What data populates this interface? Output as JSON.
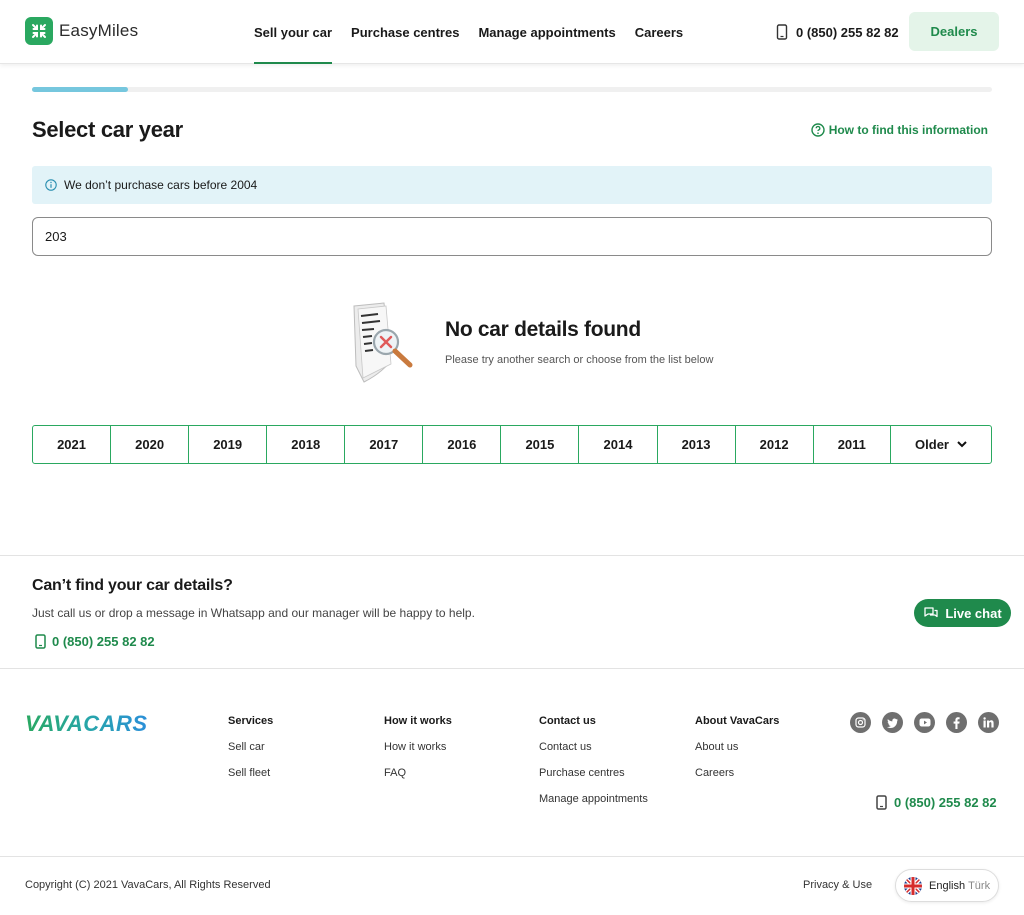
{
  "header": {
    "brand": "EasyMiles",
    "nav": [
      {
        "label": "Sell your car",
        "active": true
      },
      {
        "label": "Purchase centres",
        "active": false
      },
      {
        "label": "Manage appointments",
        "active": false
      },
      {
        "label": "Careers",
        "active": false
      }
    ],
    "phone": "0 (850) 255 82 82",
    "dealers_label": "Dealers"
  },
  "progress": {
    "fraction": 0.1
  },
  "step": {
    "title": "Select car year",
    "help_link": "How to find this information",
    "info": "We don’t purchase cars before 2004",
    "search_value": "203"
  },
  "empty_state": {
    "title": "No car details found",
    "subtitle": "Please try another search or choose from the list below"
  },
  "years": [
    "2021",
    "2020",
    "2019",
    "2018",
    "2017",
    "2016",
    "2015",
    "2014",
    "2013",
    "2012",
    "2011"
  ],
  "older_label": "Older",
  "cant_find": {
    "title": "Can’t find your car details?",
    "text": "Just call us or drop a message in Whatsapp and our manager will be happy to help.",
    "phone": "0 (850) 255 82 82",
    "live_chat": "Live chat"
  },
  "footer": {
    "logo_text": "VAVACARS",
    "columns": [
      {
        "head": "Services",
        "links": [
          "Sell car",
          "Sell fleet"
        ]
      },
      {
        "head": "How it works",
        "links": [
          "How it works",
          "FAQ"
        ]
      },
      {
        "head": "Contact us",
        "links": [
          "Contact us",
          "Purchase centres",
          "Manage appointments"
        ]
      },
      {
        "head": "About VavaCars",
        "links": [
          "About us",
          "Careers"
        ]
      }
    ],
    "socials": [
      "instagram-icon",
      "twitter-icon",
      "youtube-icon",
      "facebook-icon",
      "linkedin-icon"
    ],
    "phone": "0 (850) 255 82 82",
    "copyright": "Copyright (C) 2021 VavaCars, All Rights Reserved",
    "privacy": "Privacy & Use",
    "lang_current": "English",
    "lang_alt": "Türk"
  },
  "colors": {
    "brand_green": "#1f8a4c",
    "accent_blue": "#76c7de",
    "info_bg": "#e2f3f8"
  }
}
